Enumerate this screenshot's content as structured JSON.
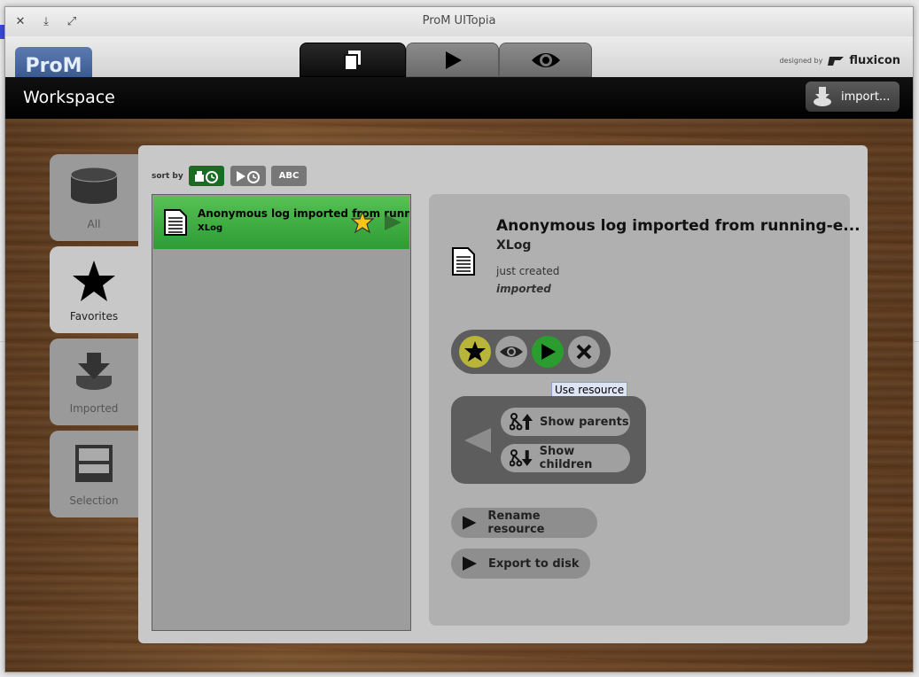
{
  "window": {
    "title": "ProM UITopia"
  },
  "header": {
    "logo_text": "ProM",
    "credit_prefix": "designed by",
    "credit_brand": "fluxicon"
  },
  "workspace": {
    "title": "Workspace",
    "import_label": "import..."
  },
  "side_tabs": [
    {
      "label": "All",
      "icon": "database-icon"
    },
    {
      "label": "Favorites",
      "icon": "star-icon"
    },
    {
      "label": "Imported",
      "icon": "import-icon"
    },
    {
      "label": "Selection",
      "icon": "selection-icon"
    }
  ],
  "sort": {
    "label": "sort by",
    "abc_label": "ABC"
  },
  "list": {
    "items": [
      {
        "title": "Anonymous log imported from running-example",
        "type": "XLog"
      }
    ]
  },
  "detail": {
    "title": "Anonymous log imported from running-e...",
    "type": "XLog",
    "created": "just created",
    "origin": "imported",
    "tooltip": "Use resource",
    "show_parents": "Show parents",
    "show_children": "Show children",
    "rename": "Rename resource",
    "export": "Export to disk"
  },
  "colors": {
    "accent_green": "#2c9c34",
    "favorite_yellow": "#f5c518"
  }
}
